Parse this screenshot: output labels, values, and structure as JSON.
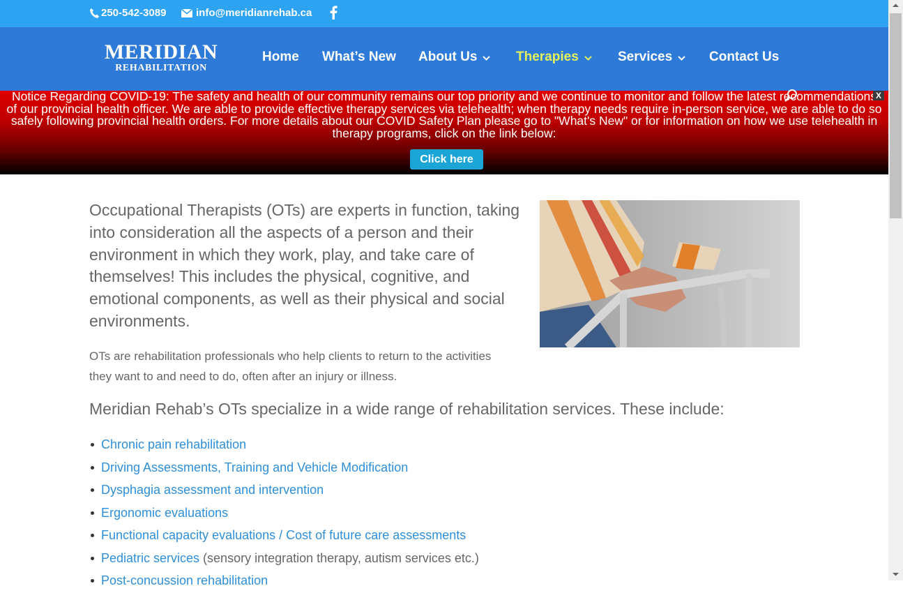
{
  "topbar": {
    "phone": "250-542-3089",
    "email": "info@meridianrehab.ca",
    "phone_icon": "phone-icon",
    "email_icon": "envelope-icon",
    "social_icon": "facebook-icon"
  },
  "logo": {
    "line1": "MERIDIAN",
    "line2": "REHABILITATION"
  },
  "nav": {
    "items": [
      {
        "label": "Home"
      },
      {
        "label": "What’s New"
      },
      {
        "label": "About Us"
      },
      {
        "label": "Therapies"
      },
      {
        "label": "Services"
      },
      {
        "label": "Contact Us"
      }
    ]
  },
  "notice": {
    "text": "Notice Regarding COVID-19: The safety and health of our community remains our top priority and we continue to monitor and follow the latest recommendations of our provincial health officer. We are able to provide effective therapy services via telehealth; when therapy needs require in-person service, we are able to do so safely following provincial health orders. For more details about our COVID Safety Plan please go to \"What's New\" or for information on how we use telehealth in therapy programs, click on the link below:",
    "button": "Click here",
    "close": "X"
  },
  "content": {
    "intro": "Occupational Therapists (OTs) are experts in function, taking into consideration all the aspects of a person and their environment in which they work, play, and take care of themselves! This includes the physical, cognitive, and emotional components, as well as their physical and social environments.",
    "p2": "OTs are rehabilitation professionals who help clients to return to the activities they want to and need to do, often after an injury or illness.",
    "h3": "Meridian Rehab’s OTs specialize in a wide range of rehabilitation services. These include:",
    "list": [
      {
        "link": "Chronic pain rehabilitation",
        "rest": ""
      },
      {
        "link": "Driving Assessments, Training and Vehicle Modification",
        "rest": ""
      },
      {
        "link": "Dysphagia assessment and intervention",
        "rest": ""
      },
      {
        "link": "Ergonomic evaluations",
        "rest": ""
      },
      {
        "link": "Functional capacity evaluations / Cost of future care assessments",
        "rest": ""
      },
      {
        "link": "Pediatric services",
        "rest": " (sensory integration therapy, autism services etc.)"
      },
      {
        "link": "Post-concussion rehabilitation",
        "rest": ""
      }
    ]
  },
  "colors": {
    "topbar": "#2ea3f2",
    "header": "#2e7ad8",
    "active_nav": "#e3f25c",
    "link": "#2e8fd9",
    "notice_red": "#e00000"
  }
}
